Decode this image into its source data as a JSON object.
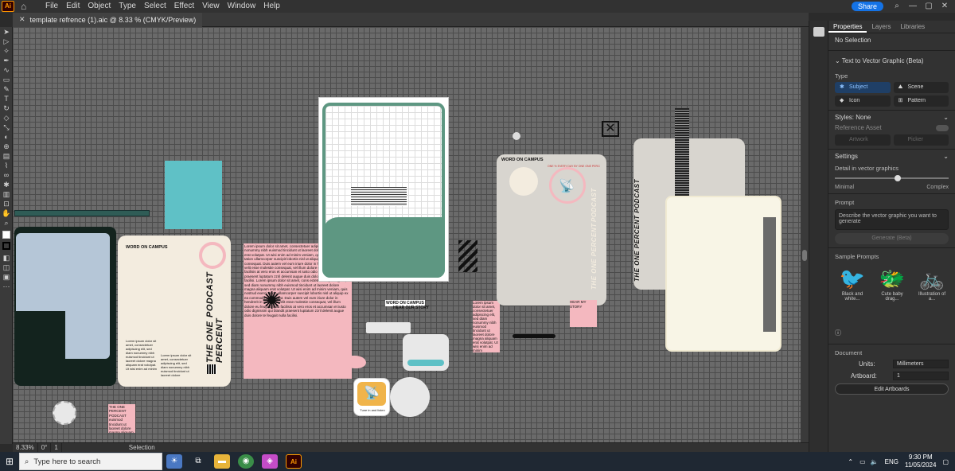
{
  "app": {
    "logo": "Ai",
    "menu": [
      "File",
      "Edit",
      "Object",
      "Type",
      "Select",
      "Effect",
      "View",
      "Window",
      "Help"
    ],
    "share": "Share"
  },
  "document": {
    "tab_title": "template refrence (1).aic @ 8.33 % (CMYK/Preview)"
  },
  "canvas": {
    "card1": {
      "header": "WORD ON CAMPUS",
      "title_line1": "THE ONE PERCENT",
      "title_line2": "PODCAST",
      "lorem_a": "Lorem ipsum dolor sit amet, consectetuer adipiscing elit, sed diam nonummy nibh euismod tincidunt ut laoreet dolore magna aliquam erat volutpat. Ut wisi enim ad minim",
      "lorem_b": "Lorem ipsum dolor sit amet, consectetuer adipiscing elit, sed diam nonummy nibh euismod tincidunt ut laoreet dolore"
    },
    "card2": {
      "header": "WORD ON CAMPUS",
      "title_line1": "THE ONE PERCENT",
      "title_line2": "PODCAST",
      "ring_text": "ONE % EVERY DAY BY ONE ONE PERCENT",
      "lorem": "Lorem ipsum dolor sit amet, consectetuer adipiscing elit, sed diam nonummy nibh euismod tincidunt ut laoreet dolore magna aliquam erat volutpat. Ut wisi enim ad minim"
    },
    "card3_title": "THE ONE PERCENT PODCAST",
    "mid_labels": {
      "word_on_campus": "WORD ON CAMPUS",
      "hear_our_story": "HEAR OUR STORY",
      "hear_my_story": "HEAR MY STORY"
    },
    "lorem_block": "Lorem ipsum dolor sit amet, consectetuer adipiscing elit, sed diam nonummy nibh euismod tincidunt ut laoreet dolore magna aliquam erat volutpat. Ut wisi enim ad minim veniam, quis nostrud exerci tation ullamcorper suscipit lobortis nisl ut aliquip ex ea commodo consequat. Duis autem vel eum iriure dolor in hendrerit in vulputate velit esse molestie consequat, vel illum dolore eu feugiat nulla facilisis at vero eros et accumsan et iusto odio dignissim qui blandit praesent luptatum zzril delenit augue duis dolore te feugait nulla facilisi. Lorem ipsum dolor sit amet, cons ectetuer adipiscing elit, sed diam nonummy nibh euismod tincidunt ut laoreet dolore magna aliquam erat volutpat. Ut wisi enim ad minim veniam, quis nostrud exerci tation ullamcorper suscipit lobortis nisl ut aliquip ex ea commodo consequat. Duis autem vel eum iriure dolor in hendrerit in vulputate velit esse molestie consequat, vel illum dolore eu feugiat nulla facilisis at vero eros et accumsan et iusto odio dignissim qui blandit praesent luptatum zzril delenit augue duis dolore te feugait nulla facilisi.",
    "bottom_note": "THE ONE PERCENT PODCAST euismod tincidunt ut laoreet dolore magna aliquam erat volutpat. Ut wisi enim ad minim",
    "app_badge": "Tune in and listen"
  },
  "statusbar": {
    "zoom": "8.33%",
    "rotation": "0°",
    "artboard": "1",
    "mode": "Selection"
  },
  "panel": {
    "tabs": [
      "Properties",
      "Layers",
      "Libraries"
    ],
    "selection": "No Selection",
    "feature": "Text to Vector Graphic (Beta)",
    "type_label": "Type",
    "types": [
      "Subject",
      "Scene",
      "Icon",
      "Pattern"
    ],
    "styles_label": "Styles:",
    "styles_value": "None",
    "reference_asset": "Reference Asset",
    "artwork": "Artwork",
    "picker": "Picker",
    "settings": "Settings",
    "detail_label": "Detail in vector graphics",
    "detail_min": "Minimal",
    "detail_max": "Complex",
    "detail_value": 0.55,
    "prompt_label": "Prompt",
    "prompt_placeholder": "Describe the vector graphic you want to generate",
    "generate": "Generate (Beta)",
    "sample_prompts": "Sample Prompts",
    "samples": [
      "Black and white...",
      "Cute baby drag...",
      "Illustration of a..."
    ],
    "document_label": "Document",
    "units_label": "Units:",
    "units_value": "Millimeters",
    "artboard_label": "Artboard:",
    "artboard_value": "1",
    "edit_artboards": "Edit Artboards"
  },
  "taskbar": {
    "search_placeholder": "Type here to search",
    "lang": "ENG",
    "time": "9:30 PM",
    "date": "11/05/2024"
  },
  "colors": {
    "accent": "#1473e6",
    "teal": "#5fc1c6",
    "green": "#5e9782",
    "cream": "#f3ecdf",
    "pink": "#f4b8bf"
  }
}
